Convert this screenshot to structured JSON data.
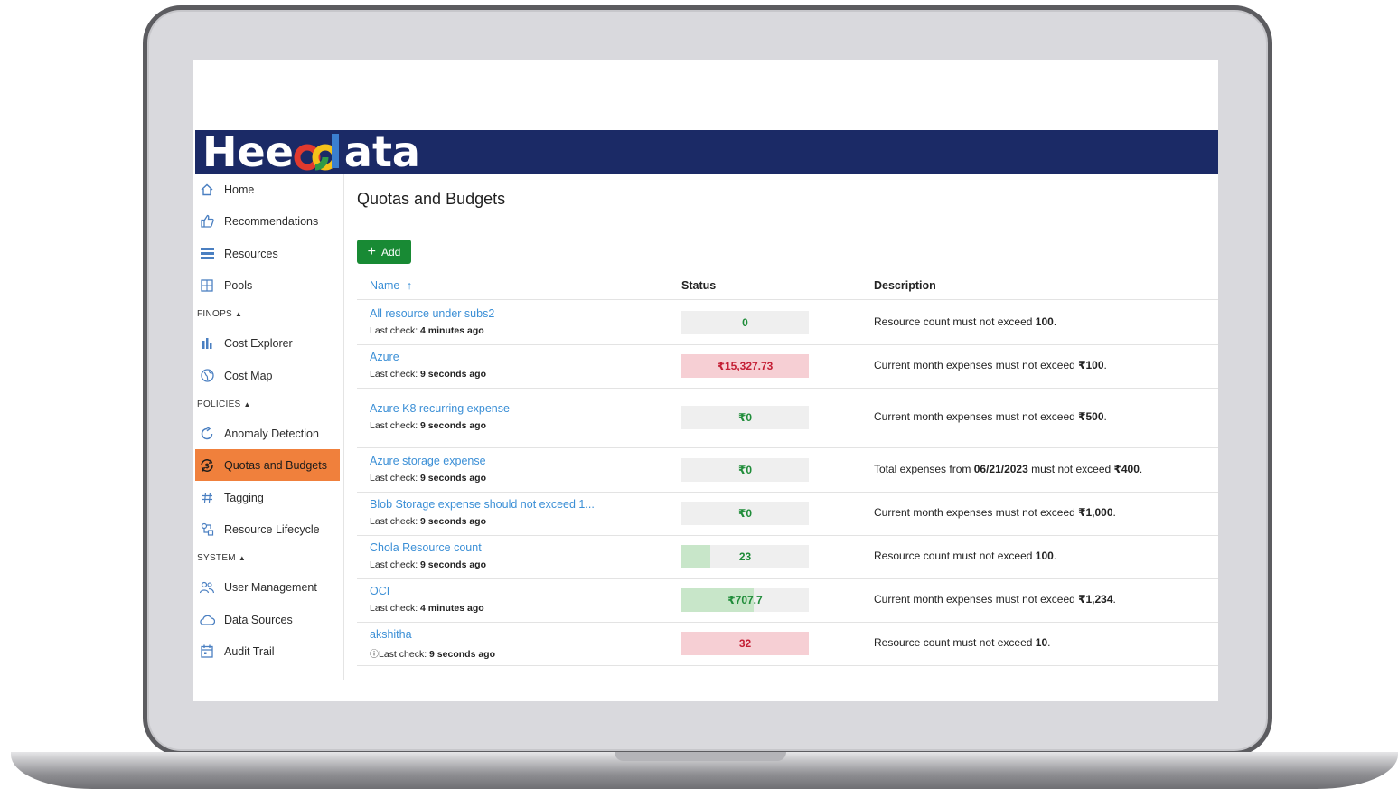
{
  "app": {
    "logo_text_a": "Hee",
    "logo_text_b": "ata",
    "brand_color": "#1b2a66",
    "accent_color": "#f0803c"
  },
  "sidebar": {
    "items": [
      {
        "label": "Home",
        "icon": "home-icon"
      },
      {
        "label": "Recommendations",
        "icon": "thumbs-up-icon"
      },
      {
        "label": "Resources",
        "icon": "list-icon"
      },
      {
        "label": "Pools",
        "icon": "grid-icon"
      },
      {
        "label": "Cost Explorer",
        "icon": "bar-chart-icon"
      },
      {
        "label": "Cost Map",
        "icon": "globe-icon"
      },
      {
        "label": "Anomaly Detection",
        "icon": "refresh-icon"
      },
      {
        "label": "Quotas and Budgets",
        "icon": "currency-cycle-icon",
        "active": true
      },
      {
        "label": "Tagging",
        "icon": "hash-icon"
      },
      {
        "label": "Resource Lifecycle",
        "icon": "lifecycle-icon"
      },
      {
        "label": "User Management",
        "icon": "users-icon"
      },
      {
        "label": "Data Sources",
        "icon": "cloud-icon"
      },
      {
        "label": "Audit Trail",
        "icon": "calendar-icon"
      }
    ],
    "sections": {
      "finops": "FINOPS",
      "policies": "POLICIES",
      "system": "SYSTEM"
    }
  },
  "main": {
    "title": "Quotas and Budgets",
    "add_label": "Add",
    "columns": {
      "name": "Name",
      "status": "Status",
      "description": "Description"
    },
    "last_check_label": "Last check:",
    "rows": [
      {
        "name": "All resource under subs2",
        "last_check": "4 minutes ago",
        "status": "0",
        "state": "ok",
        "progress": 0,
        "desc_pre": "Resource count must not exceed ",
        "desc_b1": "100",
        "desc_mid": "",
        "desc_b2": "",
        "desc_post": "."
      },
      {
        "name": "Azure",
        "last_check": "9 seconds ago",
        "status": "₹15,327.73",
        "state": "over",
        "progress": 1,
        "desc_pre": "Current month expenses must not exceed ",
        "desc_b1": "₹100",
        "desc_mid": "",
        "desc_b2": "",
        "desc_post": "."
      },
      {
        "name": "Azure K8 recurring expense",
        "last_check": "9 seconds ago",
        "status": "₹0",
        "state": "ok",
        "progress": 0,
        "desc_pre": "Current month expenses must not exceed ",
        "desc_b1": "₹500",
        "desc_mid": "",
        "desc_b2": "",
        "desc_post": "."
      },
      {
        "name": "Azure storage expense",
        "last_check": "9 seconds ago",
        "status": "₹0",
        "state": "ok",
        "progress": 0,
        "desc_pre": "Total expenses from ",
        "desc_b1": "06/21/2023",
        "desc_mid": " must not exceed ",
        "desc_b2": "₹400",
        "desc_post": "."
      },
      {
        "name": "Blob Storage expense should not exceed 1...",
        "last_check": "9 seconds ago",
        "status": "₹0",
        "state": "ok",
        "progress": 0,
        "desc_pre": "Current month expenses must not exceed ",
        "desc_b1": "₹1,000",
        "desc_mid": "",
        "desc_b2": "",
        "desc_post": "."
      },
      {
        "name": "Chola Resource count",
        "last_check": "9 seconds ago",
        "status": "23",
        "state": "ok",
        "progress": 0.23,
        "desc_pre": "Resource count must not exceed ",
        "desc_b1": "100",
        "desc_mid": "",
        "desc_b2": "",
        "desc_post": "."
      },
      {
        "name": "OCI",
        "last_check": "4 minutes ago",
        "status": "₹707.7",
        "state": "ok",
        "progress": 0.57,
        "desc_pre": "Current month expenses must not exceed ",
        "desc_b1": "₹1,234",
        "desc_mid": "",
        "desc_b2": "",
        "desc_post": "."
      },
      {
        "name": "akshitha",
        "last_check": "9 seconds ago",
        "status": "32",
        "state": "over",
        "progress": 1,
        "warn": true,
        "desc_pre": "Resource count must not exceed ",
        "desc_b1": "10",
        "desc_mid": "",
        "desc_b2": "",
        "desc_post": "."
      }
    ]
  }
}
